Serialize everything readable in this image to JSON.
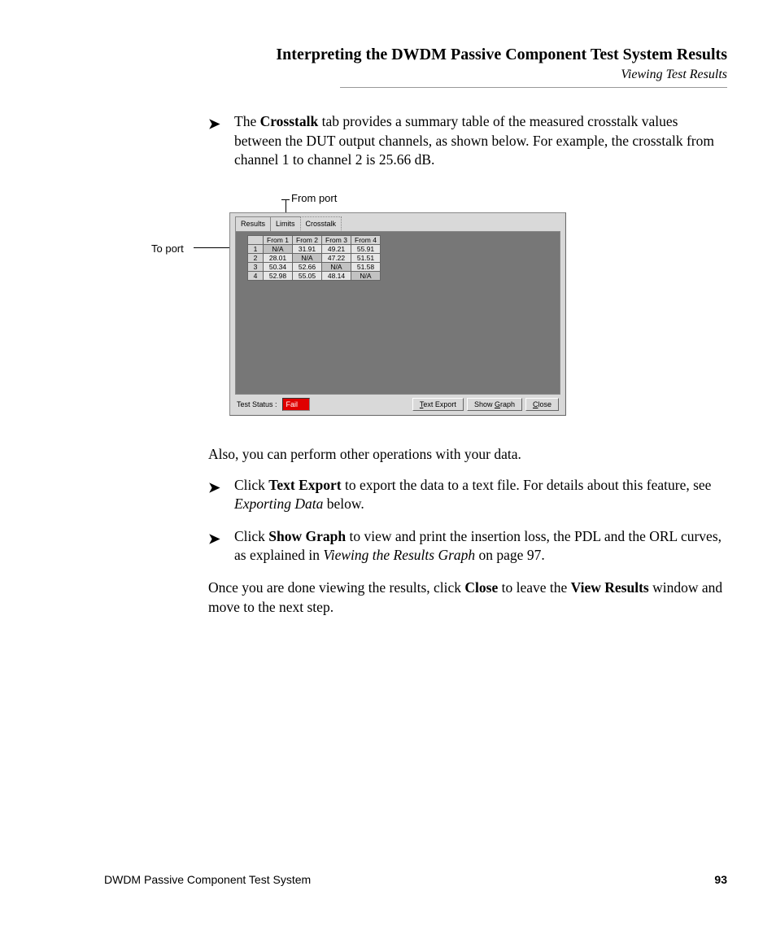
{
  "header": {
    "title": "Interpreting the DWDM Passive Component Test System Results",
    "subtitle": "Viewing Test Results"
  },
  "body": {
    "para1_pre": "The ",
    "para1_b1": "Crosstalk",
    "para1_post": " tab provides a summary table of the measured crosstalk values between the DUT output channels, as shown below. For example, the crosstalk from channel 1 to channel 2 is 25.66 dB.",
    "callout_from": "From port",
    "callout_to": "To port",
    "para2": "Also, you can perform other operations with your data.",
    "p3_pre": "Click ",
    "p3_b": "Text Export",
    "p3_mid": " to export the data to a text file. For details about this feature, see ",
    "p3_i": "Exporting Data",
    "p3_post": " below.",
    "p4_pre": "Click ",
    "p4_b": "Show Graph",
    "p4_mid": " to view and print the insertion loss, the PDL and the ORL curves, as explained in ",
    "p4_i": "Viewing the Results Graph",
    "p4_post": " on page 97.",
    "p5_pre": "Once you are done viewing the results, click ",
    "p5_b1": "Close",
    "p5_mid": " to leave the ",
    "p5_b2": "View Results",
    "p5_post": " window and move to the next step."
  },
  "screenshot": {
    "tabs": {
      "results": "Results",
      "limits": "Limits",
      "crosstalk": "Crosstalk"
    },
    "table": {
      "cols": [
        "From 1",
        "From 2",
        "From 3",
        "From 4"
      ],
      "rowhdr": [
        "1",
        "2",
        "3",
        "4"
      ],
      "rows": [
        [
          "N/A",
          "31.91",
          "49.21",
          "55.91"
        ],
        [
          "28.01",
          "N/A",
          "47.22",
          "51.51"
        ],
        [
          "50.34",
          "52.66",
          "N/A",
          "51.58"
        ],
        [
          "52.98",
          "55.05",
          "48.14",
          "N/A"
        ]
      ]
    },
    "status_label": "Test Status :",
    "status_value": "Fail",
    "buttons": {
      "text_export": "Text Export",
      "show_graph": "Show Graph",
      "close": "Close"
    },
    "underline": {
      "text_export": "T",
      "show_graph": "G",
      "close": "C"
    }
  },
  "footer": {
    "left": "DWDM Passive Component Test System",
    "page": "93"
  }
}
